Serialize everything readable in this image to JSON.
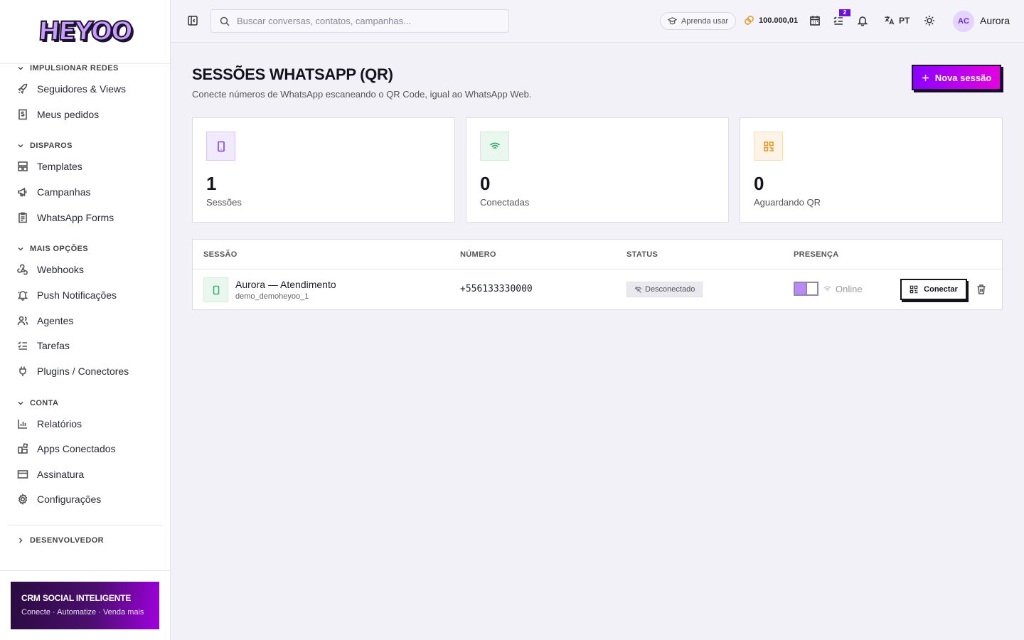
{
  "brand": {
    "logo_text": "HEYOO"
  },
  "sidebar": {
    "sections": [
      {
        "label": "IMPULSIONAR REDES",
        "items": [
          {
            "label": "Seguidores & Views",
            "icon": "rocket-icon"
          },
          {
            "label": "Meus pedidos",
            "icon": "receipt-icon"
          }
        ]
      },
      {
        "label": "DISPAROS",
        "items": [
          {
            "label": "Templates",
            "icon": "layout-icon"
          },
          {
            "label": "Campanhas",
            "icon": "megaphone-icon"
          },
          {
            "label": "WhatsApp Forms",
            "icon": "clipboard-icon"
          }
        ]
      },
      {
        "label": "MAIS OPÇÕES",
        "items": [
          {
            "label": "Webhooks",
            "icon": "webhook-icon"
          },
          {
            "label": "Push Notificações",
            "icon": "bell-icon"
          },
          {
            "label": "Agentes",
            "icon": "users-icon"
          },
          {
            "label": "Tarefas",
            "icon": "list-check-icon"
          },
          {
            "label": "Plugins / Conectores",
            "icon": "plug-icon"
          }
        ]
      },
      {
        "label": "CONTA",
        "items": [
          {
            "label": "Relatórios",
            "icon": "bar-chart-icon"
          },
          {
            "label": "Apps Conectados",
            "icon": "apps-icon"
          },
          {
            "label": "Assinatura",
            "icon": "credit-card-icon"
          },
          {
            "label": "Configurações",
            "icon": "gear-icon"
          }
        ]
      },
      {
        "label": "DESENVOLVEDOR",
        "items": []
      }
    ],
    "promo": {
      "title": "CRM SOCIAL INTELIGENTE",
      "subtitle": "Conecte · Automatize · Venda mais"
    }
  },
  "topbar": {
    "search_placeholder": "Buscar conversas, contatos, campanhas...",
    "learn_label": "Aprenda usar",
    "credits": "100.000,01",
    "tasks_badge": "2",
    "language": "PT",
    "avatar_initials": "AC",
    "user_name": "Aurora"
  },
  "page": {
    "title": "SESSÕES WHATSAPP (QR)",
    "subtitle": "Conecte números de WhatsApp escaneando o QR Code, igual ao WhatsApp Web.",
    "new_button": "Nova sessão"
  },
  "stats": [
    {
      "value": "1",
      "label": "Sessões",
      "icon": "tablet-icon",
      "color": "#7a3fe0"
    },
    {
      "value": "0",
      "label": "Conectadas",
      "icon": "wifi-icon",
      "color": "#2fa862"
    },
    {
      "value": "0",
      "label": "Aguardando QR",
      "icon": "qr-icon",
      "color": "#e09a2a"
    }
  ],
  "table": {
    "headers": [
      "SESSÃO",
      "NÚMERO",
      "STATUS",
      "PRESENÇA"
    ],
    "rows": [
      {
        "name": "Aurora — Atendimento",
        "id": "demo_demoheyoo_1",
        "number": "+556133330000",
        "status": "Desconectado",
        "presence": "Online",
        "connect_label": "Conectar"
      }
    ]
  },
  "colors": {
    "accent": "#8a00ff",
    "accent2": "#e600e0"
  }
}
